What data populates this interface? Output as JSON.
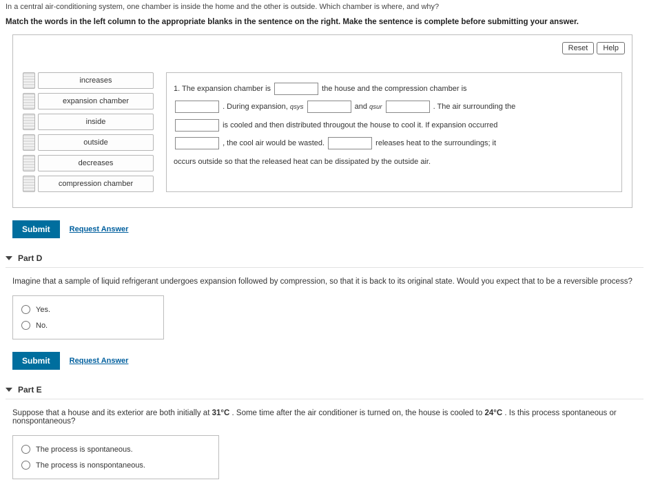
{
  "topFragment": "In a central air-conditioning system, one chamber is inside the home and the other is outside. Which chamber is where, and why?",
  "instruction": "Match the words in the left column to the appropriate blanks in the sentence on the right. Make the sentence is complete before submitting your answer.",
  "buttons": {
    "reset": "Reset",
    "help": "Help",
    "submit": "Submit",
    "requestAnswer": "Request Answer"
  },
  "terms": [
    "increases",
    "expansion chamber",
    "inside",
    "outside",
    "decreases",
    "compression chamber"
  ],
  "sentence": {
    "lead": "1. The expansion chamber is",
    "t1": "the house and the compression chamber is",
    "t2": ". During expansion, ",
    "qsys": "qsys",
    "t3": "and ",
    "qsur": "qsur",
    "t4": ". The air surrounding the",
    "t5": "is cooled and then distributed througout the house to cool it. If expansion occurred",
    "t6": ", the cool air would be wasted.",
    "t7": "releases heat to the surroundings; it",
    "t8": "occurs outside so that the released heat can be dissipated by the outside air."
  },
  "partD": {
    "title": "Part D",
    "prompt": "Imagine that a sample of liquid refrigerant undergoes expansion followed by compression, so that it is back to its original state. Would you expect that to be a reversible process?",
    "options": [
      "Yes.",
      "No."
    ]
  },
  "partE": {
    "title": "Part E",
    "prompt_a": "Suppose that a house and its exterior are both initially at ",
    "temp1": "31°C",
    "prompt_b": ". Some time after the air conditioner is turned on, the house is cooled to ",
    "temp2": "24°C",
    "prompt_c": ". Is this process spontaneous or nonspontaneous?",
    "options": [
      "The process is spontaneous.",
      "The process is nonspontaneous."
    ]
  }
}
